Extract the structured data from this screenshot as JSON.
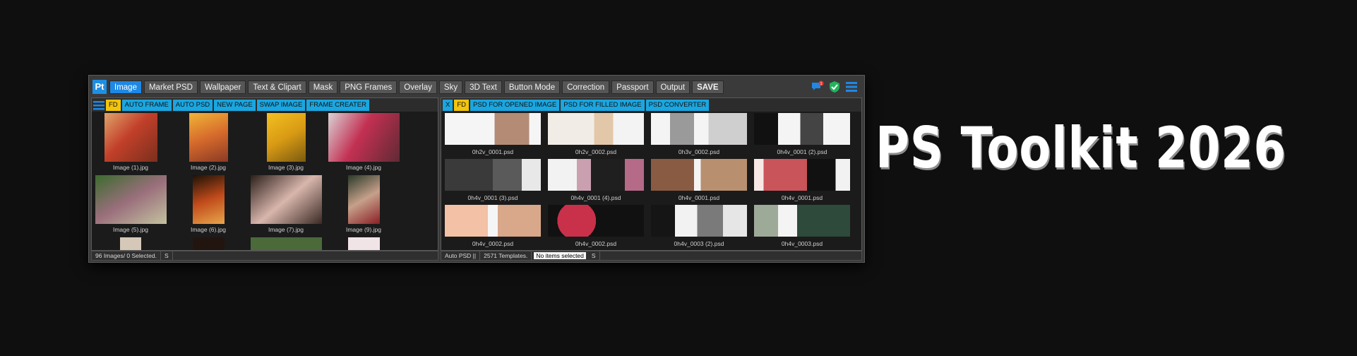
{
  "app": {
    "logo": "Pt",
    "tabs": [
      "Image",
      "Market PSD",
      "Wallpaper",
      "Text & Clipart",
      "Mask",
      "PNG Frames",
      "Overlay",
      "Sky",
      "3D Text",
      "Button Mode",
      "Correction",
      "Passport",
      "Output",
      "SAVE"
    ],
    "active_tab": "Image",
    "icons": [
      "chat-icon",
      "check-shield-icon",
      "menu-icon"
    ],
    "notification_count": "1"
  },
  "left_pane": {
    "toolbar": [
      "FD",
      "AUTO FRAME",
      "AUTO PSD",
      "NEW PAGE",
      "SWAP IMAGE",
      "FRAME CREATER"
    ],
    "images": [
      "Image (1).jpg",
      "Image (2).jpg",
      "Image (3).jpg",
      "Image (4).jpg",
      "Image (5).jpg",
      "Image (6).jpg",
      "Image (7).jpg",
      "Image (9).jpg"
    ],
    "status": [
      "96 Images/ 0 Selected.",
      "S"
    ]
  },
  "right_pane": {
    "toolbar": [
      "X",
      "FD",
      "PSD FOR OPENED IMAGE",
      "PSD FOR FILLED IMAGE",
      "PSD CONVERTER"
    ],
    "templates": [
      "0h2v_0001.psd",
      "0h2v_0002.psd",
      "0h3v_0002.psd",
      "0h4v_0001 (2).psd",
      "0h4v_0001 (3).psd",
      "0h4v_0001 (4).psd",
      "0h4v_0001.psd",
      "0h4v_0001.psd",
      "0h4v_0002.psd",
      "0h4v_0002.psd",
      "0h4v_0003 (2).psd",
      "0h4v_0003.psd"
    ],
    "status": [
      "Auto PSD ||",
      "2571 Templates.",
      "No items selected",
      "S"
    ]
  },
  "headline": "PS Toolkit 2026",
  "colors": {
    "accent": "#1e88e5",
    "toolbar_button": "#1aa6e0",
    "fd_button": "#f2c40c",
    "background": "#0f0f0f"
  }
}
